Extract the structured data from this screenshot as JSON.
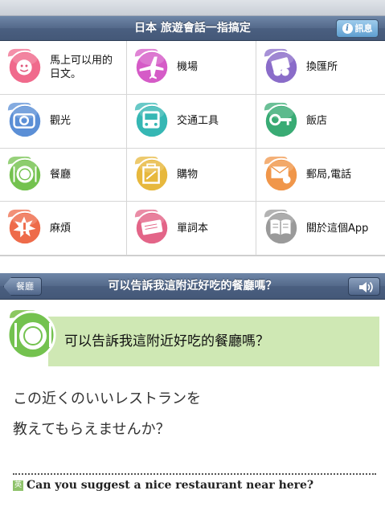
{
  "header": {
    "title": "日本 旅遊會話一指搞定",
    "info_label": "訊息"
  },
  "categories": [
    {
      "label": "馬上可以用的日文。",
      "icon": "smile-face-icon",
      "color": "#f06a8c"
    },
    {
      "label": "機場",
      "icon": "airplane-icon",
      "color": "#d55bc7"
    },
    {
      "label": "換匯所",
      "icon": "money-exchange-icon",
      "color": "#8a6cc9"
    },
    {
      "label": "觀光",
      "icon": "camera-icon",
      "color": "#5b8fd6"
    },
    {
      "label": "交通工具",
      "icon": "bus-icon",
      "color": "#36b7b4"
    },
    {
      "label": "飯店",
      "icon": "hotel-key-icon",
      "color": "#39ab74"
    },
    {
      "label": "餐廳",
      "icon": "plate-icon",
      "color": "#74c24f"
    },
    {
      "label": "購物",
      "icon": "shopping-bag-icon",
      "color": "#e7b83d"
    },
    {
      "label": "郵局,電話",
      "icon": "mail-phone-icon",
      "color": "#f0964a"
    },
    {
      "label": "麻煩",
      "icon": "trouble-icon",
      "color": "#ee6b4a"
    },
    {
      "label": "單詞本",
      "icon": "wordbook-icon",
      "color": "#e36588"
    },
    {
      "label": "關於這個App",
      "icon": "about-book-icon",
      "color": "#9a9a9a"
    }
  ],
  "detail_bar": {
    "back_label": "餐廳",
    "title": "可以告訴我這附近好吃的餐廳嗎？",
    "sound_icon": "speaker-icon"
  },
  "phrase": {
    "zh": "可以告訴我這附近好吃的餐廳嗎？",
    "ja_line1": "この近くのいいレストランを",
    "ja_line2": "教えてもらえませんか？",
    "en_badge": "英",
    "en": "Can you suggest a nice restaurant near here?"
  }
}
